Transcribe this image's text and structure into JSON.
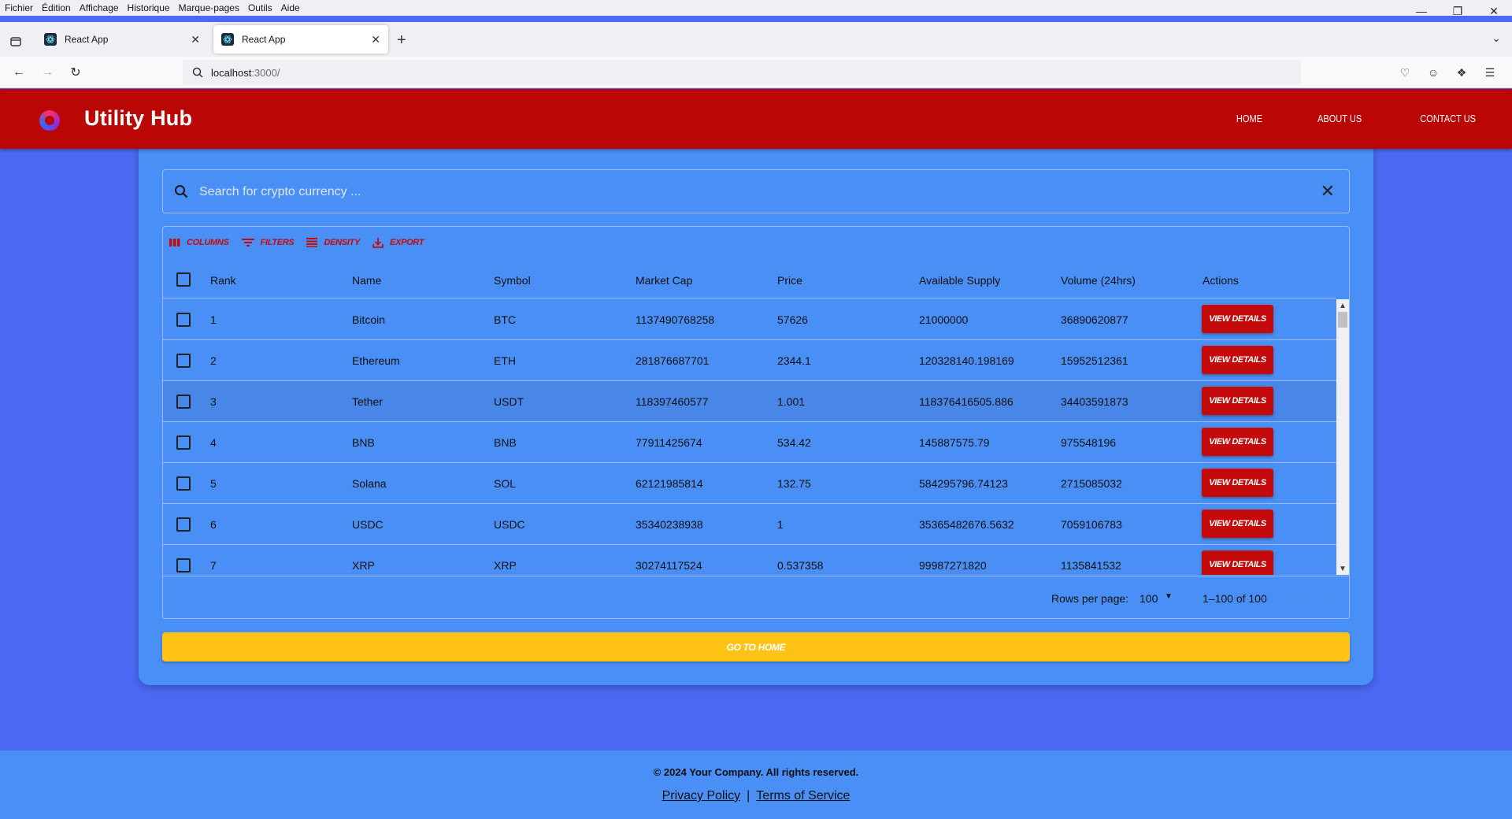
{
  "browser": {
    "menu": [
      "Fichier",
      "Édition",
      "Affichage",
      "Historique",
      "Marque-pages",
      "Outils",
      "Aide"
    ],
    "tabs": [
      {
        "title": "React App",
        "active": false
      },
      {
        "title": "React App",
        "active": true
      }
    ],
    "url_host": "localhost",
    "url_port": ":3000/"
  },
  "header": {
    "title": "Utility Hub",
    "nav": [
      "HOME",
      "ABOUT US",
      "CONTACT US"
    ],
    "bg_color": "#bb0606"
  },
  "search": {
    "placeholder": "Search for crypto currency ..."
  },
  "toolbar": {
    "columns": "Columns",
    "filters": "Filters",
    "density": "Density",
    "export": "Export"
  },
  "table": {
    "columns": [
      "Rank",
      "Name",
      "Symbol",
      "Market Cap",
      "Price",
      "Available Supply",
      "Volume (24hrs)",
      "Actions"
    ],
    "action_label": "View Details",
    "rows": [
      {
        "rank": "1",
        "name": "Bitcoin",
        "symbol": "BTC",
        "market_cap": "1137490768258",
        "price": "57626",
        "supply": "21000000",
        "volume": "36890620877"
      },
      {
        "rank": "2",
        "name": "Ethereum",
        "symbol": "ETH",
        "market_cap": "281876687701",
        "price": "2344.1",
        "supply": "120328140.198169",
        "volume": "15952512361"
      },
      {
        "rank": "3",
        "name": "Tether",
        "symbol": "USDT",
        "market_cap": "118397460577",
        "price": "1.001",
        "supply": "118376416505.886",
        "volume": "34403591873"
      },
      {
        "rank": "4",
        "name": "BNB",
        "symbol": "BNB",
        "market_cap": "77911425674",
        "price": "534.42",
        "supply": "145887575.79",
        "volume": "975548196"
      },
      {
        "rank": "5",
        "name": "Solana",
        "symbol": "SOL",
        "market_cap": "62121985814",
        "price": "132.75",
        "supply": "584295796.74123",
        "volume": "2715085032"
      },
      {
        "rank": "6",
        "name": "USDC",
        "symbol": "USDC",
        "market_cap": "35340238938",
        "price": "1",
        "supply": "35365482676.5632",
        "volume": "7059106783"
      },
      {
        "rank": "7",
        "name": "XRP",
        "symbol": "XRP",
        "market_cap": "30274117524",
        "price": "0.537358",
        "supply": "99987271820",
        "volume": "1135841532"
      }
    ],
    "highlighted_row": 3
  },
  "pagination": {
    "rows_per_page_label": "Rows per page:",
    "rows_per_page": "100",
    "range": "1–100 of 100"
  },
  "go_home": "Go to Home",
  "footer": {
    "copyright": "© 2024 Your Company. All rights reserved.",
    "privacy": "Privacy Policy",
    "separator": "|",
    "terms": "Terms of Service"
  }
}
